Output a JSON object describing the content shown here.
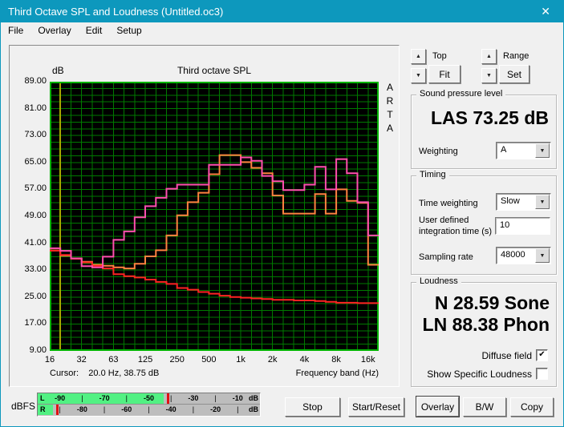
{
  "window": {
    "title": "Third Octave SPL and Loudness (Untitled.oc3)"
  },
  "icons": {
    "close": "✕",
    "up": "▲",
    "down": "▼",
    "dropdown": "▼",
    "check": "✔"
  },
  "menu": {
    "items": [
      "File",
      "Overlay",
      "Edit",
      "Setup"
    ]
  },
  "chart": {
    "db_unit_label": "dB",
    "title": "Third octave SPL",
    "watermark": "ARTA",
    "y_ticks": [
      "89.00",
      "81.00",
      "73.00",
      "65.00",
      "57.00",
      "49.00",
      "41.00",
      "33.00",
      "25.00",
      "17.00",
      "9.00"
    ],
    "x_ticks": [
      "16",
      "32",
      "63",
      "125",
      "250",
      "500",
      "1k",
      "2k",
      "4k",
      "8k",
      "16k"
    ],
    "cursor_text": "Cursor:    20.0 Hz, 38.75 dB",
    "x_axis_label": "Frequency band (Hz)",
    "colors": {
      "plot_bg": "#000000",
      "grid": "#007a00",
      "plot_border": "#00b200",
      "cursor_line": "#a8a800"
    }
  },
  "chart_data": {
    "type": "line",
    "style": "third-octave-step",
    "title": "Third octave SPL",
    "xlabel": "Frequency band (Hz)",
    "ylabel": "dB",
    "ylim": [
      9,
      89
    ],
    "y_tick_step": 8,
    "grid": true,
    "frequencies": [
      "16",
      "20",
      "25",
      "31.5",
      "40",
      "50",
      "63",
      "80",
      "100",
      "125",
      "160",
      "200",
      "250",
      "315",
      "400",
      "500",
      "630",
      "800",
      "1k",
      "1.25k",
      "1.6k",
      "2k",
      "2.5k",
      "3.15k",
      "4k",
      "5k",
      "6.3k",
      "8k",
      "10k",
      "12.5k",
      "16k"
    ],
    "series": [
      {
        "name": "red-trace",
        "color": "#ff2222",
        "values": [
          38.8,
          37.5,
          36.4,
          35.3,
          34.3,
          33.5,
          31.8,
          31.2,
          30.8,
          30.2,
          29.5,
          28.9,
          27.7,
          27.2,
          26.5,
          26.0,
          25.4,
          25.0,
          24.8,
          24.6,
          24.4,
          24.2,
          24.2,
          24.0,
          24.0,
          23.8,
          23.6,
          23.3,
          23.3,
          23.2,
          23.2
        ]
      },
      {
        "name": "orange-trace",
        "color": "#ff8240",
        "values": [
          38.8,
          37.3,
          36.4,
          35.5,
          34.6,
          34.3,
          33.8,
          33.5,
          34.9,
          37.1,
          38.9,
          43.3,
          49.3,
          53.2,
          56.0,
          61.5,
          67.2,
          67.2,
          65.1,
          63.4,
          61.8,
          55.2,
          49.8,
          49.8,
          49.8,
          55.6,
          49.8,
          57.0,
          53.6,
          53.0,
          34.6
        ]
      },
      {
        "name": "magenta-trace",
        "color": "#ff4fae",
        "values": [
          39.5,
          38.75,
          36.5,
          34.2,
          33.8,
          37.0,
          42.0,
          44.5,
          48.7,
          52.0,
          54.5,
          57.2,
          58.4,
          58.4,
          58.4,
          64.3,
          64.3,
          64.3,
          66.5,
          65.5,
          61.0,
          59.4,
          56.8,
          56.8,
          58.4,
          63.7,
          57.0,
          66.0,
          61.8,
          53.2,
          43.3
        ]
      }
    ],
    "cursor": {
      "frequency": "20.0 Hz",
      "value": "38.75 dB"
    }
  },
  "scale_controls": {
    "top_label": "Top",
    "fit_label": "Fit",
    "range_label": "Range",
    "set_label": "Set"
  },
  "spl": {
    "group_label": "Sound pressure level",
    "value_text": "LAS 73.25 dB",
    "weighting_label": "Weighting",
    "weighting_value": "A"
  },
  "timing": {
    "group_label": "Timing",
    "time_weighting_label": "Time weighting",
    "time_weighting_value": "Slow",
    "integration_label": "User defined\nintegration time (s)",
    "integration_value": "10",
    "sampling_rate_label": "Sampling rate",
    "sampling_rate_value": "48000"
  },
  "loudness": {
    "group_label": "Loudness",
    "sone_text": "N 28.59 Sone",
    "phon_text": "LN 88.38 Phon",
    "diffuse_label": "Diffuse field",
    "diffuse_checked": true,
    "show_specific_label": "Show Specific Loudness",
    "show_specific_checked": false
  },
  "meters": {
    "label": "dBFS",
    "unit": "dB",
    "colors": {
      "green": "#52f183",
      "peak": "#e11212",
      "background": "#bdbdbd"
    },
    "rows": [
      {
        "channel": "L",
        "level_percent": 56.5,
        "peak_percent": 58,
        "labels": [
          {
            "text": "-90",
            "pos": 10
          },
          {
            "text": "-70",
            "pos": 30
          },
          {
            "text": "-50",
            "pos": 50
          },
          {
            "text": "-30",
            "pos": 70
          },
          {
            "text": "-10",
            "pos": 90
          }
        ],
        "ticks": [
          20,
          40,
          60,
          80
        ]
      },
      {
        "channel": "R",
        "level_percent": 6.7,
        "peak_percent": 8.4,
        "labels": [
          {
            "text": "-80",
            "pos": 20
          },
          {
            "text": "-60",
            "pos": 40
          },
          {
            "text": "-40",
            "pos": 60
          },
          {
            "text": "-20",
            "pos": 80
          }
        ],
        "ticks": [
          10,
          30,
          50,
          70,
          90
        ]
      }
    ]
  },
  "buttons": {
    "stop": "Stop",
    "start_reset": "Start/Reset",
    "overlay": "Overlay",
    "bw": "B/W",
    "copy": "Copy"
  }
}
